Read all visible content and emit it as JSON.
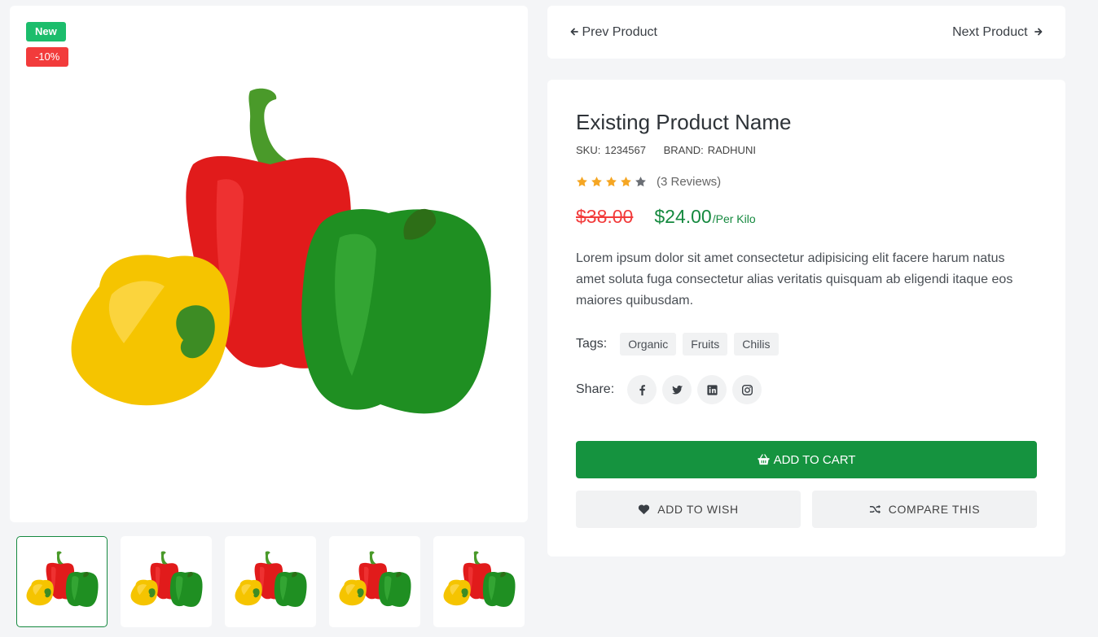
{
  "badges": {
    "new": "New",
    "discount": "-10%"
  },
  "thumbnails": [
    {
      "name": "thumb-1",
      "active": true
    },
    {
      "name": "thumb-2",
      "active": false
    },
    {
      "name": "thumb-3",
      "active": false
    },
    {
      "name": "thumb-4",
      "active": false
    },
    {
      "name": "thumb-5",
      "active": false
    }
  ],
  "nav": {
    "prev_label": "Prev Product",
    "next_label": "Next Product",
    "prev_icon": "arrow-left-icon",
    "next_icon": "arrow-right-icon"
  },
  "product": {
    "name": "Existing Product Name",
    "sku_label": "SKU:",
    "sku": "1234567",
    "brand_label": "BRAND:",
    "brand": "RADHUNI",
    "rating": 4,
    "rating_max": 5,
    "reviews": "(3 Reviews)",
    "old_price": "$38.00",
    "price": "$24.00",
    "unit": "/Per Kilo",
    "description": "Lorem ipsum dolor sit amet consectetur adipisicing elit facere harum natus amet soluta fuga consectetur alias veritatis quisquam ab eligendi itaque eos maiores quibusdam."
  },
  "tags": {
    "label": "Tags:",
    "items": [
      "Organic",
      "Fruits",
      "Chilis"
    ]
  },
  "share": {
    "label": "Share:",
    "networks": [
      "facebook-icon",
      "twitter-icon",
      "linkedin-icon",
      "instagram-icon"
    ]
  },
  "actions": {
    "add_to_cart": "ADD TO CART",
    "add_to_wish": "ADD TO WISH",
    "compare": "COMPARE THIS"
  },
  "colors": {
    "accent_green": "#15933f",
    "price_green": "#15893f",
    "sale_red": "#f23b3b",
    "new_badge": "#1cbd6c",
    "star": "#f5a623",
    "star_empty": "#6b6f75"
  }
}
